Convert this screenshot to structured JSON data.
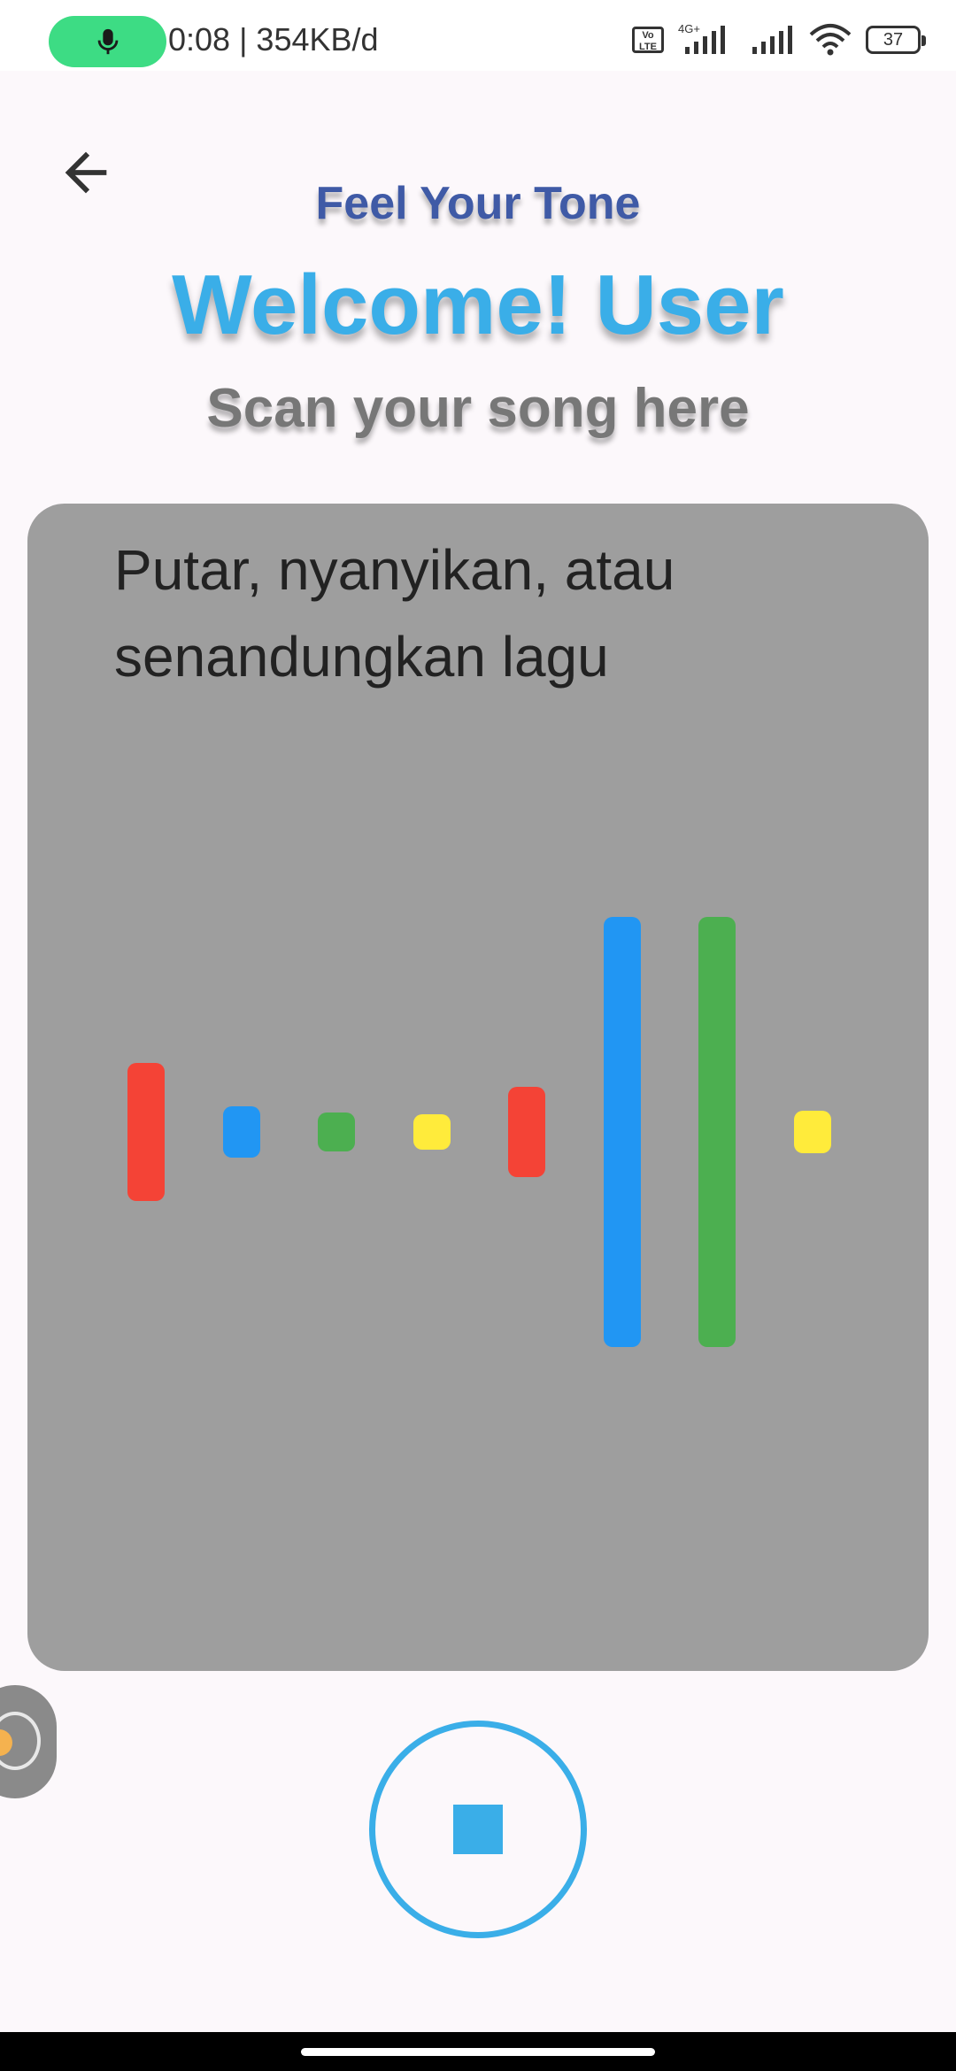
{
  "status_bar": {
    "text": "0:08 | 354KB/d",
    "network_label": "4G+",
    "volte_label": "Vo LTE",
    "battery_level": "37",
    "mic_color": "#3ddc84"
  },
  "header": {
    "app_name": "Feel Your Tone",
    "welcome": "Welcome! User",
    "instruction": "Scan your song here"
  },
  "card": {
    "prompt_line1": "Putar, nyanyikan, atau",
    "prompt_line2": "senandungkan lagu",
    "bars": [
      {
        "color": "#f44336",
        "level": 0.32
      },
      {
        "color": "#2196f3",
        "level": 0.12
      },
      {
        "color": "#4caf50",
        "level": 0.09
      },
      {
        "color": "#ffeb3b",
        "level": 0.08
      },
      {
        "color": "#f44336",
        "level": 0.21
      },
      {
        "color": "#2196f3",
        "level": 1.0
      },
      {
        "color": "#4caf50",
        "level": 1.0
      },
      {
        "color": "#ffeb3b",
        "level": 0.1
      }
    ]
  },
  "controls": {
    "stop_icon": "stop-icon",
    "accent": "#3aaee8"
  }
}
